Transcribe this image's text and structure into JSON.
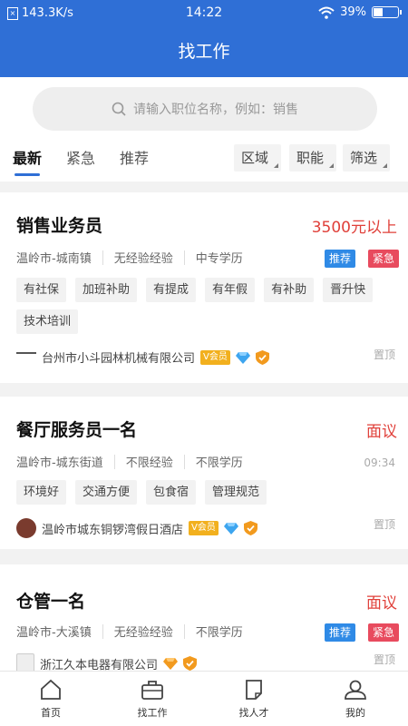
{
  "status": {
    "speed": "143.3K/s",
    "time": "14:22",
    "battery": "39%"
  },
  "header": {
    "title": "找工作"
  },
  "search": {
    "placeholder": "请输入职位名称，例如：销售"
  },
  "tabs": [
    "最新",
    "紧急",
    "推荐"
  ],
  "filters": [
    "区域",
    "职能",
    "筛选"
  ],
  "jobs": [
    {
      "title": "销售业务员",
      "salary": "3500元以上",
      "location": "温岭市-城南镇",
      "experience": "无经验经验",
      "education": "中专学历",
      "badges": [
        "推荐",
        "紧急"
      ],
      "benefits": [
        "有社保",
        "加班补助",
        "有提成",
        "有年假",
        "有补助",
        "晋升快",
        "技术培训"
      ],
      "company": "台州市小斗园林机械有限公司",
      "vip": "V会员",
      "time": "置顶"
    },
    {
      "title": "餐厅服务员一名",
      "salary": "面议",
      "location": "温岭市-城东街道",
      "experience": "不限经验",
      "education": "不限学历",
      "badges": [],
      "benefits": [
        "环境好",
        "交通方便",
        "包食宿",
        "管理规范"
      ],
      "company": "温岭市城东铜锣湾假日酒店",
      "vip": "V会员",
      "time": "09:34",
      "time2": "置顶"
    },
    {
      "title": "仓管一名",
      "salary": "面议",
      "location": "温岭市-大溪镇",
      "experience": "无经验经验",
      "education": "不限学历",
      "badges": [
        "推荐",
        "紧急"
      ],
      "benefits": [],
      "company": "浙江久本电器有限公司",
      "time": "置顶"
    }
  ],
  "nav": [
    "首页",
    "找工作",
    "找人才",
    "我的"
  ],
  "colors": {
    "primary": "#2f6fd6",
    "salary": "#e0403a",
    "recommend": "#2f8ae6",
    "urgent": "#e84b5e"
  }
}
